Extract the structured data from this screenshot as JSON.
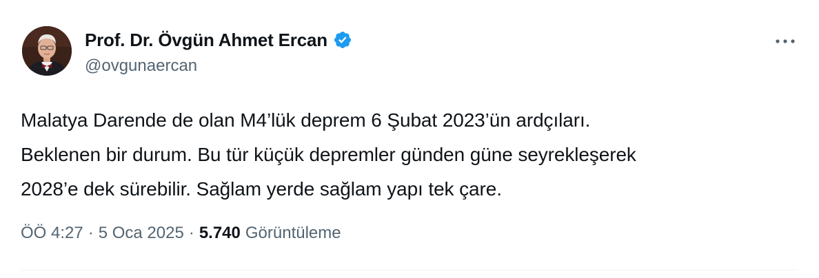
{
  "author": {
    "display_name": "Prof. Dr. Övgün Ahmet Ercan",
    "handle": "@ovgunaercan",
    "verified": true,
    "verified_color": "#1d9bf0",
    "avatar_icon": "portrait-avatar"
  },
  "more_icon": "more-horizontal-icon",
  "tweet": {
    "lines": [
      "Malatya Darende de olan M4’lük deprem 6 Şubat 2023’ün ardçıları.",
      "Beklenen bir durum. Bu tür küçük depremler günden güne seyrekleşerek",
      "2028’e dek sürebilir. Sağlam yerde sağlam yapı tek çare."
    ]
  },
  "meta": {
    "time": "ÖÖ 4:27",
    "separator": "·",
    "date": "5 Oca 2025",
    "views_count": "5.740",
    "views_label": "Görüntüleme"
  }
}
